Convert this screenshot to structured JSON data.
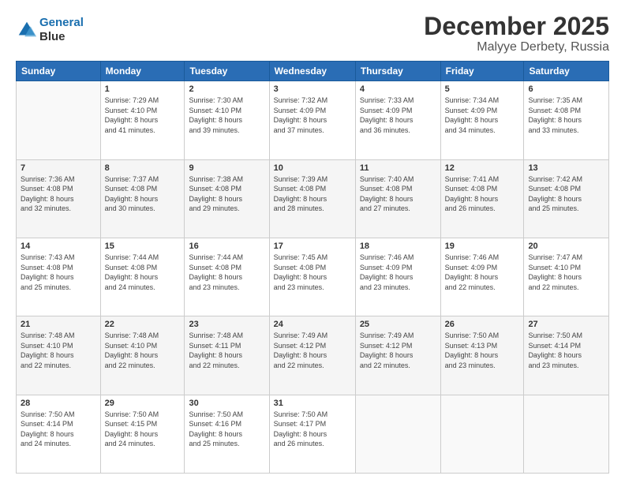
{
  "logo": {
    "line1": "General",
    "line2": "Blue"
  },
  "title": "December 2025",
  "subtitle": "Malyye Derbety, Russia",
  "days_header": [
    "Sunday",
    "Monday",
    "Tuesday",
    "Wednesday",
    "Thursday",
    "Friday",
    "Saturday"
  ],
  "weeks": [
    [
      {
        "day": "",
        "info": ""
      },
      {
        "day": "1",
        "info": "Sunrise: 7:29 AM\nSunset: 4:10 PM\nDaylight: 8 hours\nand 41 minutes."
      },
      {
        "day": "2",
        "info": "Sunrise: 7:30 AM\nSunset: 4:10 PM\nDaylight: 8 hours\nand 39 minutes."
      },
      {
        "day": "3",
        "info": "Sunrise: 7:32 AM\nSunset: 4:09 PM\nDaylight: 8 hours\nand 37 minutes."
      },
      {
        "day": "4",
        "info": "Sunrise: 7:33 AM\nSunset: 4:09 PM\nDaylight: 8 hours\nand 36 minutes."
      },
      {
        "day": "5",
        "info": "Sunrise: 7:34 AM\nSunset: 4:09 PM\nDaylight: 8 hours\nand 34 minutes."
      },
      {
        "day": "6",
        "info": "Sunrise: 7:35 AM\nSunset: 4:08 PM\nDaylight: 8 hours\nand 33 minutes."
      }
    ],
    [
      {
        "day": "7",
        "info": "Sunrise: 7:36 AM\nSunset: 4:08 PM\nDaylight: 8 hours\nand 32 minutes."
      },
      {
        "day": "8",
        "info": "Sunrise: 7:37 AM\nSunset: 4:08 PM\nDaylight: 8 hours\nand 30 minutes."
      },
      {
        "day": "9",
        "info": "Sunrise: 7:38 AM\nSunset: 4:08 PM\nDaylight: 8 hours\nand 29 minutes."
      },
      {
        "day": "10",
        "info": "Sunrise: 7:39 AM\nSunset: 4:08 PM\nDaylight: 8 hours\nand 28 minutes."
      },
      {
        "day": "11",
        "info": "Sunrise: 7:40 AM\nSunset: 4:08 PM\nDaylight: 8 hours\nand 27 minutes."
      },
      {
        "day": "12",
        "info": "Sunrise: 7:41 AM\nSunset: 4:08 PM\nDaylight: 8 hours\nand 26 minutes."
      },
      {
        "day": "13",
        "info": "Sunrise: 7:42 AM\nSunset: 4:08 PM\nDaylight: 8 hours\nand 25 minutes."
      }
    ],
    [
      {
        "day": "14",
        "info": "Sunrise: 7:43 AM\nSunset: 4:08 PM\nDaylight: 8 hours\nand 25 minutes."
      },
      {
        "day": "15",
        "info": "Sunrise: 7:44 AM\nSunset: 4:08 PM\nDaylight: 8 hours\nand 24 minutes."
      },
      {
        "day": "16",
        "info": "Sunrise: 7:44 AM\nSunset: 4:08 PM\nDaylight: 8 hours\nand 23 minutes."
      },
      {
        "day": "17",
        "info": "Sunrise: 7:45 AM\nSunset: 4:08 PM\nDaylight: 8 hours\nand 23 minutes."
      },
      {
        "day": "18",
        "info": "Sunrise: 7:46 AM\nSunset: 4:09 PM\nDaylight: 8 hours\nand 23 minutes."
      },
      {
        "day": "19",
        "info": "Sunrise: 7:46 AM\nSunset: 4:09 PM\nDaylight: 8 hours\nand 22 minutes."
      },
      {
        "day": "20",
        "info": "Sunrise: 7:47 AM\nSunset: 4:10 PM\nDaylight: 8 hours\nand 22 minutes."
      }
    ],
    [
      {
        "day": "21",
        "info": "Sunrise: 7:48 AM\nSunset: 4:10 PM\nDaylight: 8 hours\nand 22 minutes."
      },
      {
        "day": "22",
        "info": "Sunrise: 7:48 AM\nSunset: 4:10 PM\nDaylight: 8 hours\nand 22 minutes."
      },
      {
        "day": "23",
        "info": "Sunrise: 7:48 AM\nSunset: 4:11 PM\nDaylight: 8 hours\nand 22 minutes."
      },
      {
        "day": "24",
        "info": "Sunrise: 7:49 AM\nSunset: 4:12 PM\nDaylight: 8 hours\nand 22 minutes."
      },
      {
        "day": "25",
        "info": "Sunrise: 7:49 AM\nSunset: 4:12 PM\nDaylight: 8 hours\nand 22 minutes."
      },
      {
        "day": "26",
        "info": "Sunrise: 7:50 AM\nSunset: 4:13 PM\nDaylight: 8 hours\nand 23 minutes."
      },
      {
        "day": "27",
        "info": "Sunrise: 7:50 AM\nSunset: 4:14 PM\nDaylight: 8 hours\nand 23 minutes."
      }
    ],
    [
      {
        "day": "28",
        "info": "Sunrise: 7:50 AM\nSunset: 4:14 PM\nDaylight: 8 hours\nand 24 minutes."
      },
      {
        "day": "29",
        "info": "Sunrise: 7:50 AM\nSunset: 4:15 PM\nDaylight: 8 hours\nand 24 minutes."
      },
      {
        "day": "30",
        "info": "Sunrise: 7:50 AM\nSunset: 4:16 PM\nDaylight: 8 hours\nand 25 minutes."
      },
      {
        "day": "31",
        "info": "Sunrise: 7:50 AM\nSunset: 4:17 PM\nDaylight: 8 hours\nand 26 minutes."
      },
      {
        "day": "",
        "info": ""
      },
      {
        "day": "",
        "info": ""
      },
      {
        "day": "",
        "info": ""
      }
    ]
  ]
}
